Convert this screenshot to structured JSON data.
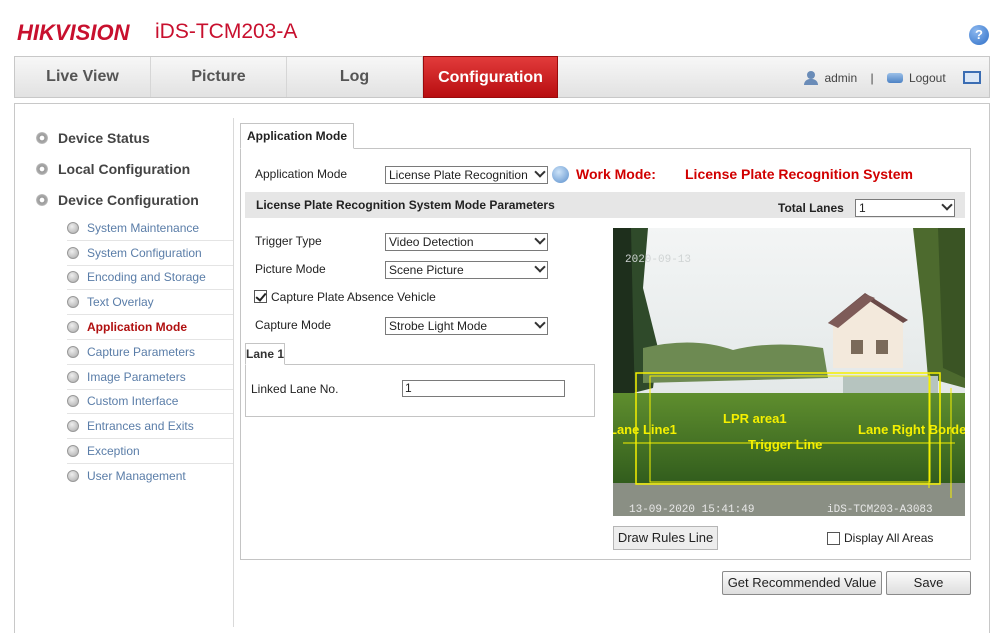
{
  "header": {
    "logo": "HIKVISION",
    "model": "iDS-TCM203-A",
    "help_icon": "?"
  },
  "nav": {
    "tabs": [
      "Live View",
      "Picture",
      "Log",
      "Configuration"
    ],
    "active": "Configuration",
    "user": "admin",
    "separator": "|",
    "logout": "Logout"
  },
  "sidebar": {
    "main": [
      "Device Status",
      "Local Configuration",
      "Device Configuration"
    ],
    "sub": [
      "System Maintenance",
      "System Configuration",
      "Encoding and Storage",
      "Text Overlay",
      "Application Mode",
      "Capture Parameters",
      "Image Parameters",
      "Custom Interface",
      "Entrances and Exits",
      "Exception",
      "User Management"
    ],
    "active": "Application Mode"
  },
  "content": {
    "tab": "Application Mode",
    "app_mode_label": "Application Mode",
    "app_mode_value": "License Plate Recognition",
    "work_mode_label": "Work Mode:",
    "work_mode_value": "License Plate Recognition System",
    "section_title": "License Plate Recognition System Mode Parameters",
    "total_lanes_label": "Total Lanes",
    "total_lanes_value": "1",
    "trigger_type_label": "Trigger Type",
    "trigger_type_value": "Video Detection",
    "picture_mode_label": "Picture Mode",
    "picture_mode_value": "Scene Picture",
    "capture_absence_label": "Capture Plate Absence Vehicle",
    "capture_absence_checked": true,
    "capture_mode_label": "Capture Mode",
    "capture_mode_value": "Strobe Light Mode",
    "lane_tab": "Lane 1",
    "linked_lane_label": "Linked Lane No.",
    "linked_lane_value": "1",
    "draw_rules_button": "Draw Rules Line",
    "display_all_areas_label": "Display All Areas",
    "display_all_areas_checked": false,
    "get_recommended_button": "Get Recommended Value",
    "save_button": "Save"
  },
  "video": {
    "osd_top": "2020-09-13",
    "osd_timestamp": "13-09-2020 15:41:49",
    "osd_device": "iDS-TCM203-A3083",
    "overlay_lpr": "LPR area1",
    "overlay_trigger": "Trigger Line",
    "overlay_left": "Lane Line1",
    "overlay_right": "Lane Right Border"
  },
  "colors": {
    "brand_red": "#c8102e",
    "active_tab": "#c81518",
    "work_mode_red": "#d10000",
    "link_blue": "#5a7da8",
    "overlay_yellow": "#f5f000"
  }
}
